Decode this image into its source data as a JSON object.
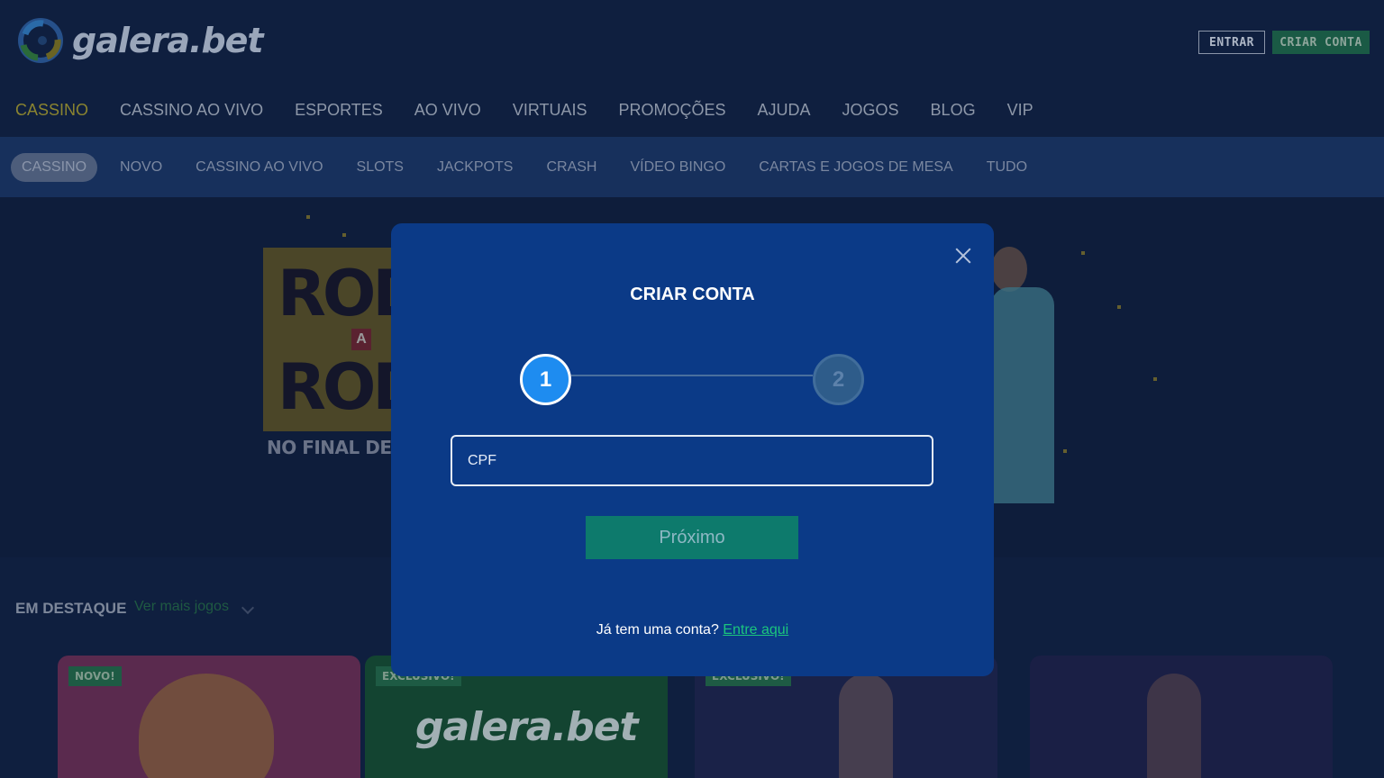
{
  "brand": {
    "logo_text": "galera.bet",
    "colors": {
      "logo_blue": "#2a7bd4",
      "logo_green": "#24b055",
      "logo_yellow": "#f0c020",
      "accent_green": "#1bc57d"
    }
  },
  "header": {
    "login_label": "ENTRAR",
    "register_label": "CRIAR CONTA"
  },
  "main_nav": {
    "items": [
      {
        "label": "CASSINO",
        "active": true
      },
      {
        "label": "CASSINO AO VIVO"
      },
      {
        "label": "ESPORTES"
      },
      {
        "label": "AO VIVO"
      },
      {
        "label": "VIRTUAIS"
      },
      {
        "label": "PROMOÇÕES"
      },
      {
        "label": "AJUDA"
      },
      {
        "label": "JOGOS"
      },
      {
        "label": "BLOG"
      },
      {
        "label": "VIP"
      }
    ]
  },
  "sub_nav": {
    "items": [
      {
        "label": "CASSINO",
        "active": true
      },
      {
        "label": "NOVO"
      },
      {
        "label": "CASSINO AO VIVO"
      },
      {
        "label": "SLOTS"
      },
      {
        "label": "JACKPOTS"
      },
      {
        "label": "CRASH"
      },
      {
        "label": "VÍDEO BINGO"
      },
      {
        "label": "CARTAS E JOGOS DE MESA"
      },
      {
        "label": "TUDO"
      }
    ]
  },
  "banner": {
    "line1": "ROD",
    "connector": "A",
    "line2": "ROD",
    "subtitle": "NO FINAL DE SE"
  },
  "featured": {
    "title": "EM DESTAQUE",
    "more_label": "Ver mais jogos",
    "cards": [
      {
        "badge": "NOVO!"
      },
      {
        "badge": "EXCLUSIVO!",
        "title": "galera.bet"
      },
      {
        "badge": "EXCLUSIVO!"
      },
      {
        "badge": ""
      }
    ]
  },
  "modal": {
    "title": "CRIAR CONTA",
    "steps": [
      "1",
      "2"
    ],
    "current_step": 1,
    "cpf_placeholder": "CPF",
    "next_label": "Próximo",
    "login_prompt": "Já tem uma conta?",
    "login_link": "Entre aqui"
  }
}
